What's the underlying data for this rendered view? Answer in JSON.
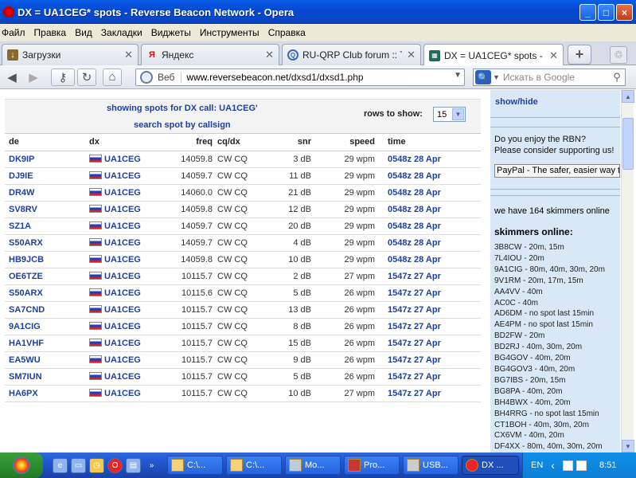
{
  "window": {
    "title": "DX = UA1CEG* spots - Reverse Beacon Network - Opera",
    "controls": [
      "_",
      "□",
      "×"
    ]
  },
  "menu": [
    "Файл",
    "Правка",
    "Вид",
    "Закладки",
    "Виджеты",
    "Инструменты",
    "Справка"
  ],
  "tabs": [
    {
      "label": "Загрузки",
      "icon": "download-icon"
    },
    {
      "label": "Яндекс",
      "icon": "yandex-icon"
    },
    {
      "label": "RU-QRP Club forum :: T...",
      "icon": "forum-icon"
    },
    {
      "label": "DX = UA1CEG* spots - ...",
      "icon": "rbn-icon"
    }
  ],
  "nav": {
    "web_label": "Веб",
    "url_host": "www.reversebeacon.net",
    "url_path": "/dxsd1/dxsd1.php",
    "search_placeholder": "Искать в Google"
  },
  "page": {
    "showing": "showing spots for DX call: UA1CEG'",
    "search_link": "search spot by callsign",
    "rows_label": "rows to show:",
    "rows_value": "15",
    "columns": [
      "de",
      "dx",
      "freq",
      "cq/dx",
      "snr",
      "speed",
      "time"
    ],
    "rows": [
      [
        "DK9IP",
        "UA1CEG",
        "14059.8",
        "CW CQ",
        "3 dB",
        "29 wpm",
        "0548z 28 Apr"
      ],
      [
        "DJ9IE",
        "UA1CEG",
        "14059.7",
        "CW CQ",
        "11 dB",
        "29 wpm",
        "0548z 28 Apr"
      ],
      [
        "DR4W",
        "UA1CEG",
        "14060.0",
        "CW CQ",
        "21 dB",
        "29 wpm",
        "0548z 28 Apr"
      ],
      [
        "SV8RV",
        "UA1CEG",
        "14059.8",
        "CW CQ",
        "12 dB",
        "29 wpm",
        "0548z 28 Apr"
      ],
      [
        "SZ1A",
        "UA1CEG",
        "14059.7",
        "CW CQ",
        "20 dB",
        "29 wpm",
        "0548z 28 Apr"
      ],
      [
        "S50ARX",
        "UA1CEG",
        "14059.7",
        "CW CQ",
        "4 dB",
        "29 wpm",
        "0548z 28 Apr"
      ],
      [
        "HB9JCB",
        "UA1CEG",
        "14059.8",
        "CW CQ",
        "10 dB",
        "29 wpm",
        "0548z 28 Apr"
      ],
      [
        "OE6TZE",
        "UA1CEG",
        "10115.7",
        "CW CQ",
        "2 dB",
        "27 wpm",
        "1547z 27 Apr"
      ],
      [
        "S50ARX",
        "UA1CEG",
        "10115.6",
        "CW CQ",
        "5 dB",
        "26 wpm",
        "1547z 27 Apr"
      ],
      [
        "SA7CND",
        "UA1CEG",
        "10115.7",
        "CW CQ",
        "13 dB",
        "26 wpm",
        "1547z 27 Apr"
      ],
      [
        "9A1CIG",
        "UA1CEG",
        "10115.7",
        "CW CQ",
        "8 dB",
        "26 wpm",
        "1547z 27 Apr"
      ],
      [
        "HA1VHF",
        "UA1CEG",
        "10115.7",
        "CW CQ",
        "15 dB",
        "26 wpm",
        "1547z 27 Apr"
      ],
      [
        "EA5WU",
        "UA1CEG",
        "10115.7",
        "CW CQ",
        "9 dB",
        "26 wpm",
        "1547z 27 Apr"
      ],
      [
        "SM7IUN",
        "UA1CEG",
        "10115.7",
        "CW CQ",
        "5 dB",
        "26 wpm",
        "1547z 27 Apr"
      ],
      [
        "HA6PX",
        "UA1CEG",
        "10115.7",
        "CW CQ",
        "10 dB",
        "27 wpm",
        "1547z 27 Apr"
      ]
    ]
  },
  "sidebar": {
    "showhide": "show/hide",
    "enjoy_line1": "Do you enjoy the RBN?",
    "enjoy_line2": "Please consider supporting us!",
    "paypal": "PayPal - The safer, easier way t",
    "online": "we have 164 skimmers online",
    "skimmers_title": "skimmers online:",
    "skimmers": [
      "3B8CW - 20m, 15m",
      "7L4IOU - 20m",
      "9A1CIG - 80m, 40m, 30m, 20m",
      "9V1RM - 20m, 17m, 15m",
      "AA4VV - 40m",
      "AC0C - 40m",
      "AD6DM - no spot last 15min",
      "AE4PM - no spot last 15min",
      "BD2FW - 20m",
      "BD2RJ - 40m, 30m, 20m",
      "BG4GOV - 40m, 20m",
      "BG4GOV3 - 40m, 20m",
      "BG7IBS - 20m, 15m",
      "BG8PA - 40m, 20m",
      "BH4BWX - 40m, 20m",
      "BH4RRG - no spot last 15min",
      "CT1BOH - 40m, 30m, 20m",
      "CX6VM - 40m, 20m",
      "DF4XX - 80m, 40m, 30m, 20m"
    ]
  },
  "taskbar": {
    "buttons": [
      "C:\\...",
      "C:\\...",
      "Mo...",
      "Pro...",
      "USB...",
      "DX ..."
    ],
    "lang": "EN",
    "clock": "8:51"
  }
}
